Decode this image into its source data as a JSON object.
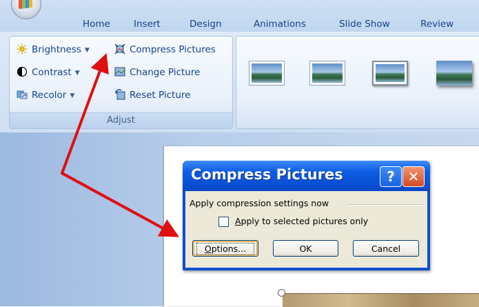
{
  "tabs": [
    "Home",
    "Insert",
    "Design",
    "Animations",
    "Slide Show",
    "Review"
  ],
  "adjust_group": {
    "label": "Adjust",
    "commands": {
      "brightness": "Brightness",
      "contrast": "Contrast",
      "recolor": "Recolor",
      "compress": "Compress Pictures",
      "change": "Change Picture",
      "reset": "Reset Picture"
    }
  },
  "dialog": {
    "title": "Compress Pictures",
    "help_label": "?",
    "close_label": "✕",
    "heading": "Apply compression settings now",
    "checkbox_label_prefix": "A",
    "checkbox_label_rest": "pply to selected pictures only",
    "checkbox_checked": false,
    "options_prefix": "O",
    "options_rest": "ptions...",
    "ok_label": "OK",
    "cancel_label": "Cancel"
  },
  "colors": {
    "annotation_arrow": "#e01010",
    "titlebar": "#0a50d0"
  }
}
